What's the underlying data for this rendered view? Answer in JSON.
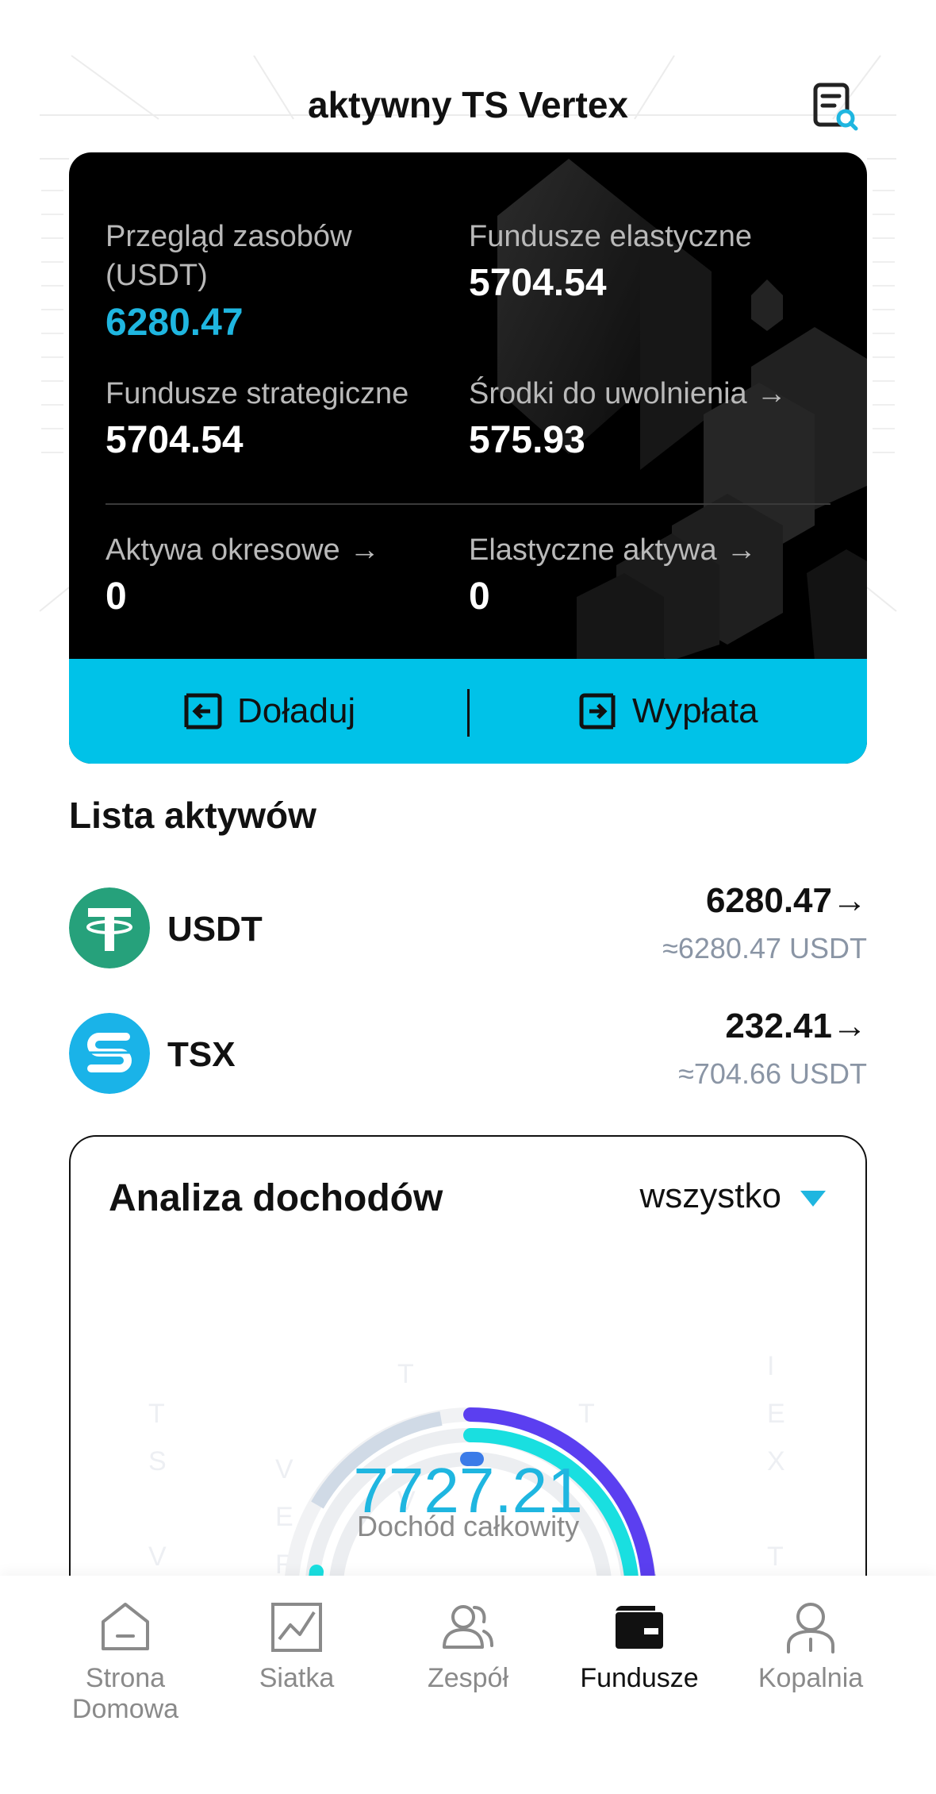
{
  "header": {
    "title": "aktywny TS Vertex"
  },
  "overview": {
    "total_label": "Przegląd zasobów (USDT)",
    "total_value": "6280.47",
    "flexible_funds_label": "Fundusze elastyczne",
    "flexible_funds_value": "5704.54",
    "strategic_funds_label": "Fundusze strategiczne",
    "strategic_funds_value": "5704.54",
    "releasable_label": "Środki do uwolnienia",
    "releasable_value": "575.93",
    "periodic_assets_label": "Aktywa okresowe",
    "periodic_assets_value": "0",
    "flexible_assets_label": "Elastyczne aktywa",
    "flexible_assets_value": "0",
    "deposit_label": "Doładuj",
    "withdraw_label": "Wypłata"
  },
  "assets": {
    "title": "Lista aktywów",
    "items": [
      {
        "name": "USDT",
        "amount": "6280.47",
        "approx": "≈6280.47 USDT",
        "icon": "usdt-logo-icon",
        "color": "#26a17b"
      },
      {
        "name": "TSX",
        "amount": "232.41",
        "approx": "≈704.66 USDT",
        "icon": "tsx-logo-icon",
        "color": "#1ab3e8"
      }
    ]
  },
  "income": {
    "title": "Analiza dochodów",
    "period": "wszystko",
    "total_value": "7727.21",
    "total_label": "Dochód całkowity"
  },
  "nav": {
    "items": [
      {
        "label": "Strona Domowa",
        "icon": "home-icon",
        "active": false
      },
      {
        "label": "Siatka",
        "icon": "chart-icon",
        "active": false
      },
      {
        "label": "Zespół",
        "icon": "team-icon",
        "active": false
      },
      {
        "label": "Fundusze",
        "icon": "wallet-icon",
        "active": true
      },
      {
        "label": "Kopalnia",
        "icon": "user-icon",
        "active": false
      }
    ]
  },
  "colors": {
    "accent": "#1fb6e0",
    "action_bar": "#00c2e8",
    "ring_purple": "#5b3ff0",
    "ring_cyan": "#19dfe0",
    "ring_blue": "#3b7be8"
  }
}
